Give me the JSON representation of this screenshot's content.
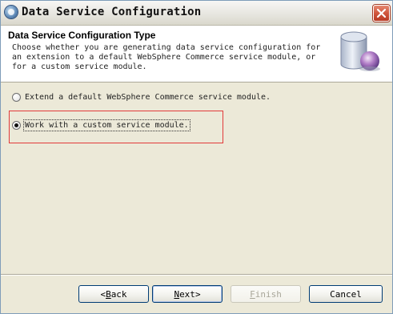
{
  "window": {
    "title": "Data Service Configuration",
    "close_icon": "close-icon"
  },
  "header": {
    "title": "Data Service Configuration Type",
    "description": "Choose whether you are generating data service configuration for\nan extension to a default WebSphere Commerce service module, or\nfor a custom service module.",
    "graphic_icon": "database-wizard-banner-icon"
  },
  "options": [
    {
      "label": "Extend a default WebSphere Commerce service module.",
      "selected": false
    },
    {
      "label": "Work with a custom service module.",
      "selected": true
    }
  ],
  "buttons": {
    "back": {
      "mnemonic": "B",
      "rest": "ack",
      "prefix": "< ",
      "enabled": true
    },
    "next": {
      "mnemonic": "N",
      "rest": "ext",
      "suffix": " >",
      "enabled": true
    },
    "finish": {
      "mnemonic": "F",
      "rest": "inish",
      "enabled": false
    },
    "cancel": {
      "label": "Cancel",
      "enabled": true
    }
  },
  "colors": {
    "dialog_bg": "#ece9d8",
    "header_bg": "#ffffff",
    "highlight_border": "#e23a3a",
    "button_border": "#003c74"
  }
}
